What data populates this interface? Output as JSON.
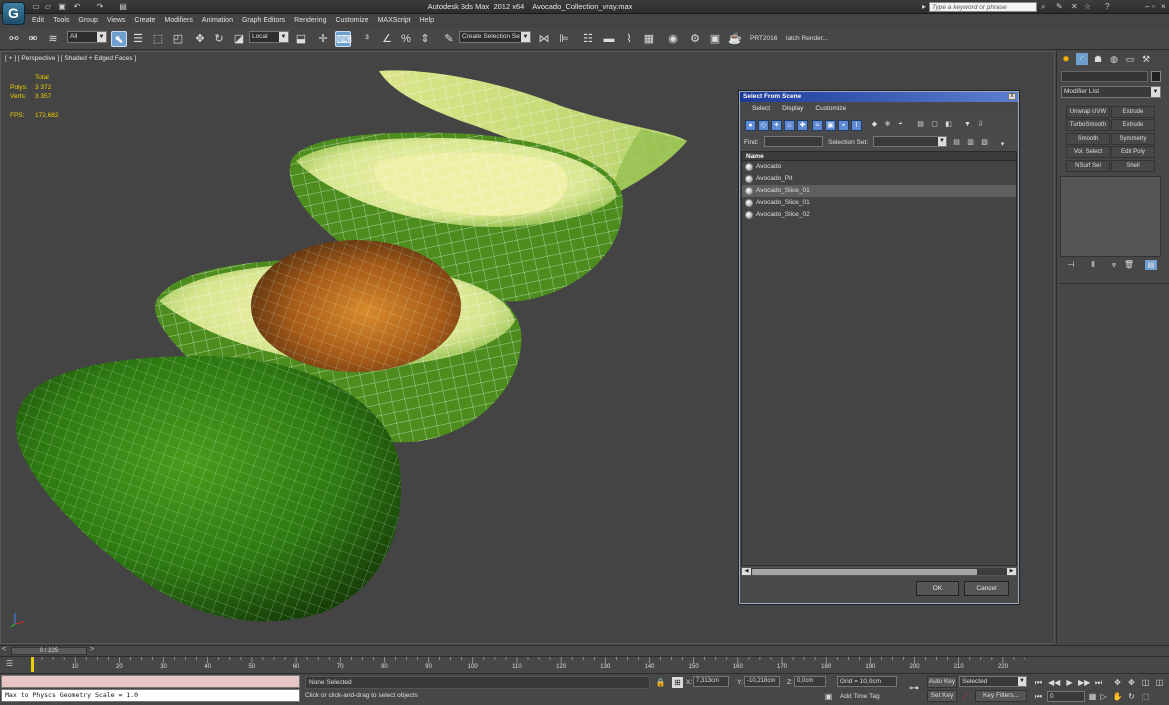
{
  "window": {
    "title": "Autodesk 3ds Max  2012 x64    Avocado_Collection_vray.max",
    "search_placeholder": "Type a keyword or phrase"
  },
  "menu": [
    "Edit",
    "Tools",
    "Group",
    "Views",
    "Create",
    "Modifiers",
    "Animation",
    "Graph Editors",
    "Rendering",
    "Customize",
    "MAXScript",
    "Help"
  ],
  "toolbar": {
    "selection_filter": "All",
    "ref_coord": "Local",
    "named_selection": "Create Selection Se",
    "prt_label": "PRT2016",
    "batch_render_label": "latch Render..."
  },
  "viewport": {
    "label": "[ + ] [ Perspective ] [ Shaded + Edged Faces ]",
    "stats": {
      "total_label": "Total",
      "polys_label": "Polys:",
      "polys": "3 372",
      "verts_label": "Verts:",
      "verts": "3 357",
      "fps_label": "FPS:",
      "fps": "172,682"
    },
    "colors": {
      "skin": "#2e7a12",
      "flesh": "#e6ee9a",
      "pit": "#b0651c",
      "wire": "#ffffff"
    }
  },
  "dialog": {
    "title": "Select From Scene",
    "close": "x",
    "menu": [
      "Select",
      "Display",
      "Customize"
    ],
    "find_label": "Find:",
    "find_value": "",
    "selection_set_label": "Selection Set:",
    "column_header": "Name",
    "objects": [
      {
        "name": "Avocado",
        "selected": false
      },
      {
        "name": "Avocado_Pit",
        "selected": false
      },
      {
        "name": "Avocado_Slice_01",
        "selected": true
      },
      {
        "name": "Avocado_Slice_01",
        "selected": false
      },
      {
        "name": "Avocado_Slice_02",
        "selected": false
      }
    ],
    "ok_label": "OK",
    "cancel_label": "Cancel"
  },
  "command_panel": {
    "modifier_list": "Modifier List",
    "modifier_buttons": [
      "Unwrap UVW",
      "Extrude",
      "TurboSmooth",
      "Extrude",
      "Smooth",
      "Symmetry",
      "Vol. Select",
      "Edit Poly",
      "NSurf Sel",
      "Shell"
    ]
  },
  "timeline": {
    "frame_display": "0 / 225",
    "ticks": [
      "10",
      "20",
      "30",
      "40",
      "50",
      "60",
      "70",
      "80",
      "90",
      "100",
      "110",
      "120",
      "130",
      "140",
      "150",
      "160",
      "170",
      "180",
      "190",
      "200",
      "210",
      "220"
    ]
  },
  "status": {
    "maxscript_output": "Max to Physcs Geometry Scale = 1.0",
    "selection_status": "None Selected",
    "prompt": "Click or click-and-drag to select objects",
    "x_label": "X:",
    "x_value": "7,313cm",
    "y_label": "Y:",
    "y_value": "-10,218cm",
    "z_label": "Z:",
    "z_value": "0,0cm",
    "grid": "Grid = 10,0cm",
    "add_time_tag": "Add Time Tag",
    "auto_key": "Auto Key",
    "auto_key_mode": "Selected",
    "set_key": "Set Key",
    "key_filters": "Key Filters...",
    "current_frame": "0"
  }
}
